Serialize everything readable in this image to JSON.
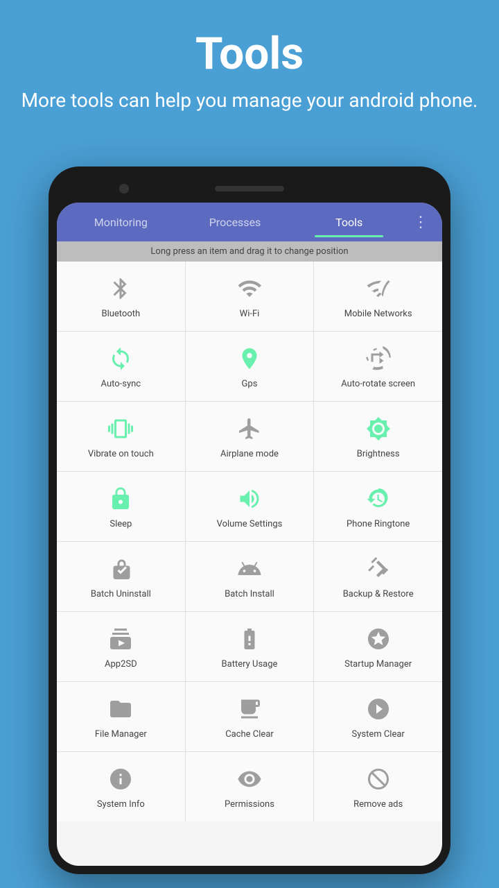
{
  "header": {
    "title": "Tools",
    "subtitle": "More tools can help you manage your android phone."
  },
  "tabs": [
    {
      "id": "monitoring",
      "label": "Monitoring",
      "active": false
    },
    {
      "id": "processes",
      "label": "Processes",
      "active": false
    },
    {
      "id": "tools",
      "label": "Tools",
      "active": true
    }
  ],
  "hint": "Long press an item and drag it to change position",
  "menu_icon": "⋮",
  "tools": [
    {
      "id": "bluetooth",
      "label": "Bluetooth",
      "color": "gray"
    },
    {
      "id": "wifi",
      "label": "Wi-Fi",
      "color": "gray"
    },
    {
      "id": "mobile-networks",
      "label": "Mobile Networks",
      "color": "gray"
    },
    {
      "id": "auto-sync",
      "label": "Auto-sync",
      "color": "green"
    },
    {
      "id": "gps",
      "label": "Gps",
      "color": "green"
    },
    {
      "id": "auto-rotate",
      "label": "Auto-rotate screen",
      "color": "gray"
    },
    {
      "id": "vibrate",
      "label": "Vibrate on touch",
      "color": "green"
    },
    {
      "id": "airplane",
      "label": "Airplane mode",
      "color": "gray"
    },
    {
      "id": "brightness",
      "label": "Brightness",
      "color": "green"
    },
    {
      "id": "sleep",
      "label": "Sleep",
      "color": "green"
    },
    {
      "id": "volume",
      "label": "Volume Settings",
      "color": "green"
    },
    {
      "id": "ringtone",
      "label": "Phone Ringtone",
      "color": "green"
    },
    {
      "id": "batch-uninstall",
      "label": "Batch Uninstall",
      "color": "gray"
    },
    {
      "id": "batch-install",
      "label": "Batch Install",
      "color": "gray"
    },
    {
      "id": "backup-restore",
      "label": "Backup & Restore",
      "color": "gray"
    },
    {
      "id": "app2sd",
      "label": "App2SD",
      "color": "gray"
    },
    {
      "id": "battery",
      "label": "Battery Usage",
      "color": "gray"
    },
    {
      "id": "startup",
      "label": "Startup Manager",
      "color": "gray"
    },
    {
      "id": "file-manager",
      "label": "File Manager",
      "color": "gray"
    },
    {
      "id": "cache-clear",
      "label": "Cache Clear",
      "color": "gray"
    },
    {
      "id": "system-clear",
      "label": "System Clear",
      "color": "gray"
    },
    {
      "id": "system-info",
      "label": "System Info",
      "color": "gray"
    },
    {
      "id": "permissions",
      "label": "Permissions",
      "color": "gray"
    },
    {
      "id": "remove-ads",
      "label": "Remove ads",
      "color": "gray"
    }
  ]
}
